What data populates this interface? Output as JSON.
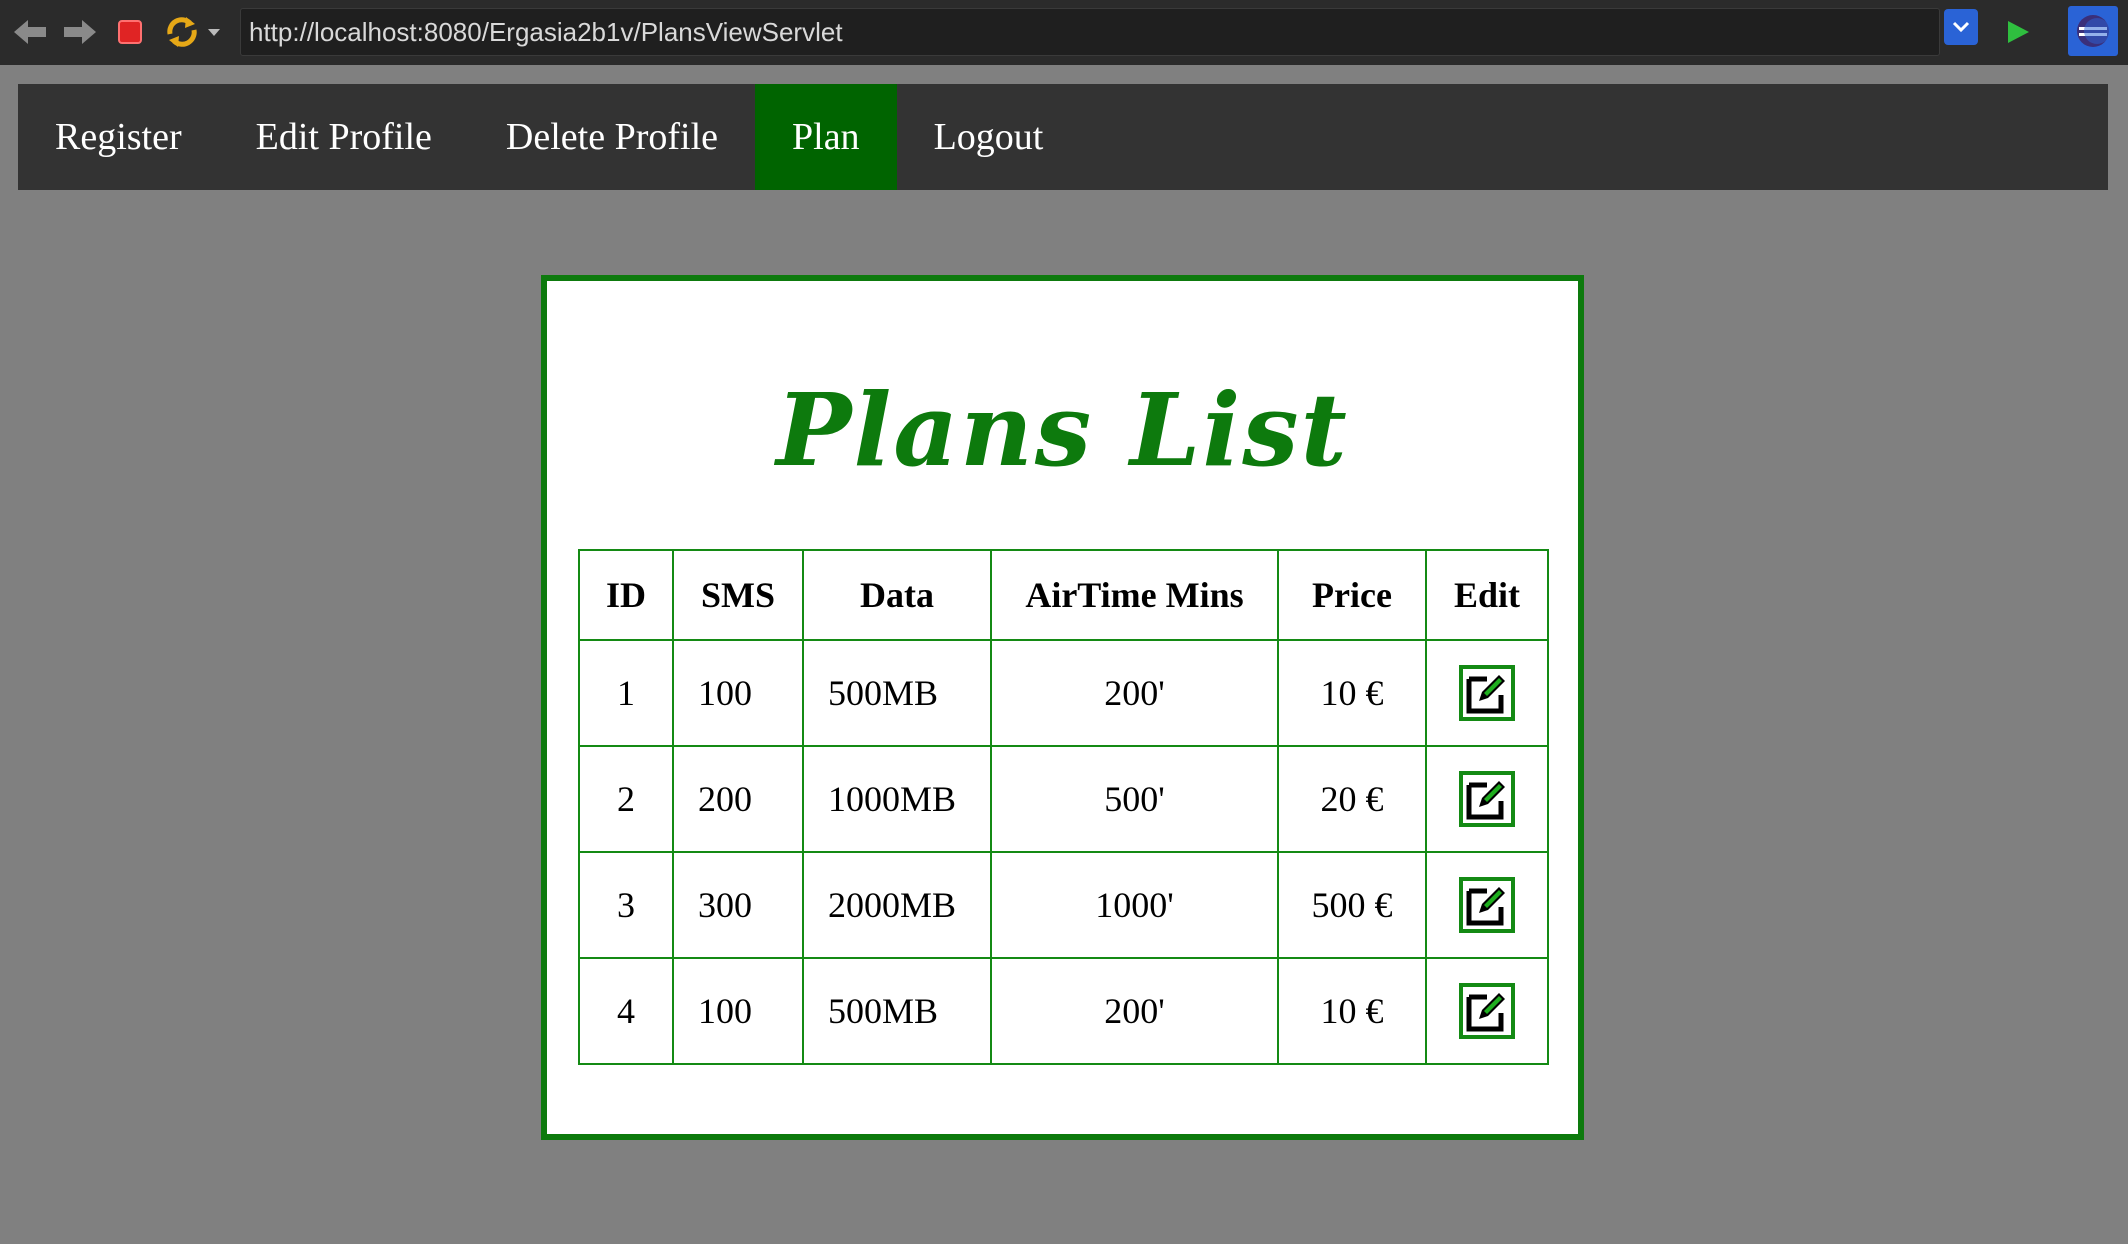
{
  "browser": {
    "url": "http://localhost:8080/Ergasia2b1v/PlansViewServlet"
  },
  "nav": {
    "items": [
      {
        "label": "Register",
        "active": false
      },
      {
        "label": "Edit Profile",
        "active": false
      },
      {
        "label": "Delete Profile",
        "active": false
      },
      {
        "label": "Plan",
        "active": true
      },
      {
        "label": "Logout",
        "active": false
      }
    ],
    "active_color": "#006400"
  },
  "card": {
    "title": "Plans List",
    "accent_color": "#0d7a0d"
  },
  "table": {
    "headers": [
      "ID",
      "SMS",
      "Data",
      "AirTime Mins",
      "Price",
      "Edit"
    ],
    "rows": [
      {
        "id": "1",
        "sms": "100",
        "data": "500MB",
        "airtime": "200'",
        "price": "10 €",
        "edit_icon": "edit-icon"
      },
      {
        "id": "2",
        "sms": "200",
        "data": "1000MB",
        "airtime": "500'",
        "price": "20 €",
        "edit_icon": "edit-icon"
      },
      {
        "id": "3",
        "sms": "300",
        "data": "2000MB",
        "airtime": "1000'",
        "price": "500 €",
        "edit_icon": "edit-icon"
      },
      {
        "id": "4",
        "sms": "100",
        "data": "500MB",
        "airtime": "200'",
        "price": "10 €",
        "edit_icon": "edit-icon"
      }
    ]
  }
}
